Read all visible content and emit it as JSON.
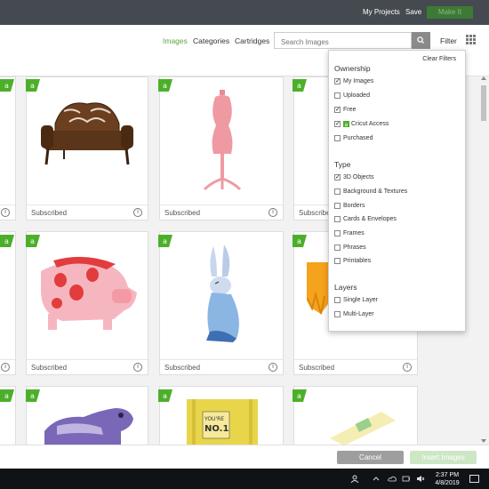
{
  "topbar": {
    "my_projects": "My Projects",
    "save": "Save",
    "make_it": "Make It"
  },
  "nav": {
    "tabs": [
      "Images",
      "Categories",
      "Cartridges"
    ],
    "search_placeholder": "Search Images",
    "filter": "Filter"
  },
  "cards": {
    "footer_label": "Subscribed",
    "info_glyph": "i",
    "items": [
      "couch",
      "dress-form",
      "pig",
      "rabbit",
      "partial-orange",
      "hippo",
      "nova-box",
      "tag"
    ]
  },
  "filters": {
    "clear": "Clear Filters",
    "ownership": {
      "title": "Ownership",
      "options": [
        {
          "label": "My Images",
          "checked": true
        },
        {
          "label": "Uploaded",
          "checked": false
        },
        {
          "label": "Free",
          "checked": true
        },
        {
          "label": "Cricut Access",
          "checked": true
        },
        {
          "label": "Purchased",
          "checked": false
        }
      ]
    },
    "type": {
      "title": "Type",
      "options": [
        {
          "label": "3D Objects",
          "checked": true
        },
        {
          "label": "Background & Textures",
          "checked": false
        },
        {
          "label": "Borders",
          "checked": false
        },
        {
          "label": "Cards & Envelopes",
          "checked": false
        },
        {
          "label": "Frames",
          "checked": false
        },
        {
          "label": "Phrases",
          "checked": false
        },
        {
          "label": "Printables",
          "checked": false
        }
      ]
    },
    "layers": {
      "title": "Layers",
      "options": [
        {
          "label": "Single Layer",
          "checked": false
        },
        {
          "label": "Multi-Layer",
          "checked": false
        }
      ]
    }
  },
  "footer": {
    "cancel": "Cancel",
    "insert": "Insert Images"
  },
  "taskbar": {
    "time": "2:37 PM",
    "date": "4/8/2019"
  },
  "colors": {
    "accent": "#5ea33c",
    "topbar": "#444a4f",
    "badge": "#4caf2a",
    "insert_disabled": "#cde6c4"
  }
}
